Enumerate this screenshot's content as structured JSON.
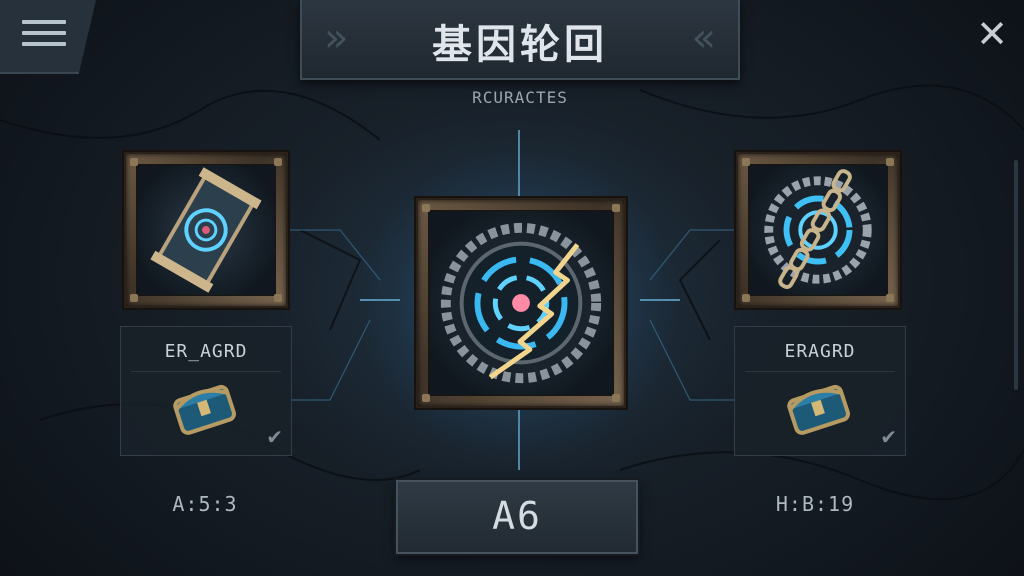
{
  "header": {
    "title": "基因轮回",
    "subtitle": "RCURACTES"
  },
  "left_slot": {
    "label": "ER_AGRD",
    "stat": "A:5:3",
    "icon": "scroll-target-icon",
    "item_icon": "chest-icon",
    "check_icon": "checkmark-icon"
  },
  "right_slot": {
    "label": "ERAGRD",
    "stat": "H:B:19",
    "icon": "chained-gear-icon",
    "item_icon": "chest-icon",
    "check_icon": "checkmark-icon"
  },
  "center": {
    "icon": "gear-lightning-icon",
    "button_label": "A6"
  },
  "controls": {
    "menu_icon": "hamburger-menu-icon",
    "close_icon": "close-icon",
    "close_glyph": "✕"
  },
  "colors": {
    "background": "#151c24",
    "glow": "#46aae6",
    "frame": "#6d5a45",
    "text": "#dfe5ea"
  }
}
